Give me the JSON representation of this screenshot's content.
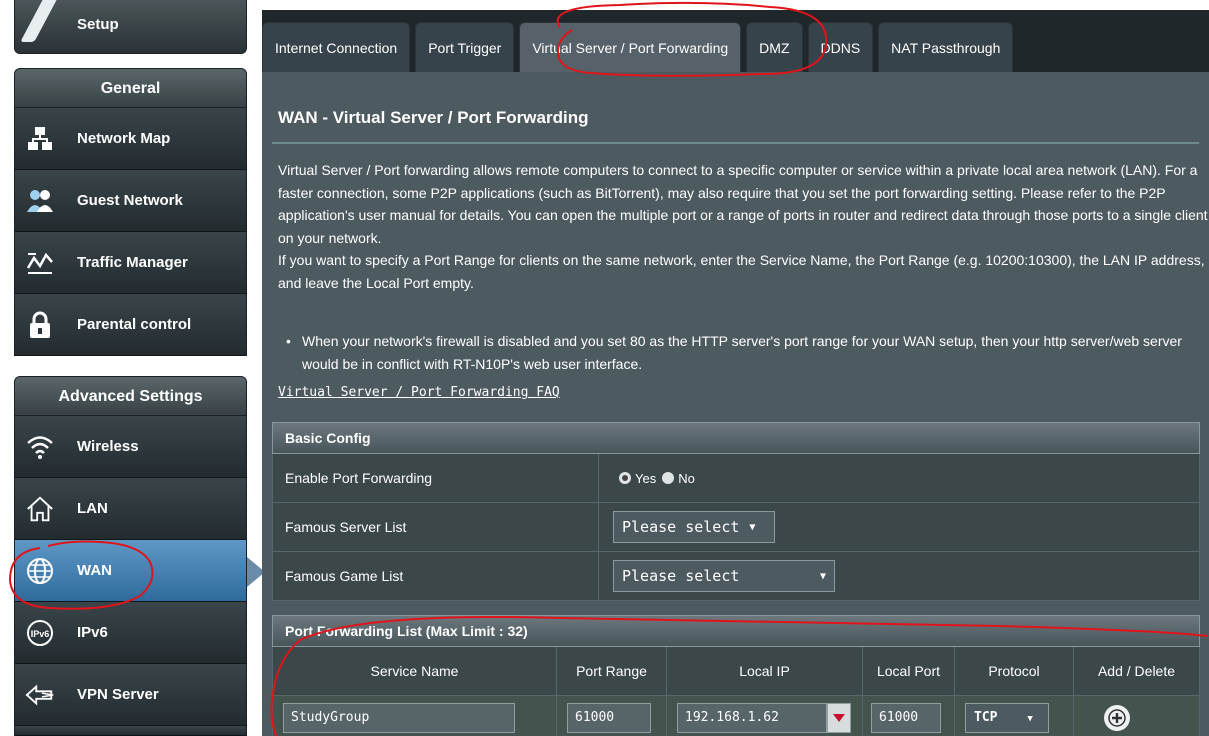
{
  "sidebar": {
    "top_label": "Setup",
    "general_header": "General",
    "general_items": [
      {
        "label": "Network Map",
        "icon": "network-map-icon"
      },
      {
        "label": "Guest Network",
        "icon": "guest-network-icon"
      },
      {
        "label": "Traffic Manager",
        "icon": "traffic-manager-icon"
      },
      {
        "label": "Parental control",
        "icon": "lock-icon"
      }
    ],
    "advanced_header": "Advanced Settings",
    "advanced_items": [
      {
        "label": "Wireless",
        "icon": "wifi-icon"
      },
      {
        "label": "LAN",
        "icon": "home-icon"
      },
      {
        "label": "WAN",
        "icon": "globe-icon"
      },
      {
        "label": "IPv6",
        "icon": "ipv6-icon"
      },
      {
        "label": "VPN Server",
        "icon": "vpn-icon"
      }
    ],
    "active_item": "WAN"
  },
  "tabs": [
    {
      "label": "Internet Connection"
    },
    {
      "label": "Port Trigger"
    },
    {
      "label": "Virtual Server / Port Forwarding"
    },
    {
      "label": "DMZ"
    },
    {
      "label": "DDNS"
    },
    {
      "label": "NAT Passthrough"
    }
  ],
  "active_tab": "Virtual Server / Port Forwarding",
  "page": {
    "title": "WAN - Virtual Server / Port Forwarding",
    "description_1": "Virtual Server / Port forwarding allows remote computers to connect to a specific computer or service within a private local area network (LAN). For a faster connection, some P2P applications (such as BitTorrent), may also require that you set the port forwarding setting. Please refer to the P2P application's user manual for details. You can open the multiple port or a range of ports in router and redirect data through those ports to a single client on your network.",
    "description_2": "If you want to specify a Port Range for clients on the same network, enter the Service Name, the Port Range (e.g. 10200:10300), the LAN IP address, and leave the Local Port empty.",
    "bullet": "When your network's firewall is disabled and you set 80 as the HTTP server's port range for your WAN setup, then your http server/web server would be in conflict with RT-N10P's web user interface.",
    "faq_link": "Virtual Server / Port Forwarding FAQ"
  },
  "basic_config": {
    "header": "Basic Config",
    "enable_label": "Enable Port Forwarding",
    "yes_label": "Yes",
    "no_label": "No",
    "enabled": "Yes",
    "server_list_label": "Famous Server List",
    "server_list_value": "Please select",
    "game_list_label": "Famous Game List",
    "game_list_value": "Please select"
  },
  "port_list": {
    "header": "Port Forwarding List (Max Limit : 32)",
    "columns": [
      "Service Name",
      "Port Range",
      "Local IP",
      "Local Port",
      "Protocol",
      "Add / Delete"
    ],
    "input_row": {
      "service_name": "StudyGroup",
      "port_range": "61000",
      "local_ip": "192.168.1.62",
      "local_port": "61000",
      "protocol": "TCP"
    }
  },
  "colors": {
    "annotation": "#e0141b",
    "active_sidebar": "#3c7bb0",
    "panel": "#4d5a5f"
  }
}
